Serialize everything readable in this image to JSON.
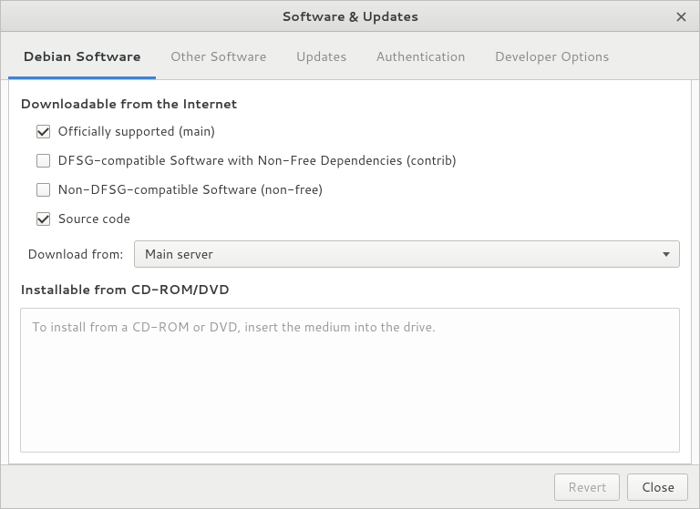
{
  "window": {
    "title": "Software & Updates"
  },
  "tabs": [
    {
      "label": "Debian Software",
      "active": true
    },
    {
      "label": "Other Software"
    },
    {
      "label": "Updates"
    },
    {
      "label": "Authentication"
    },
    {
      "label": "Developer Options"
    }
  ],
  "sections": {
    "downloadable_label": "Downloadable from the Internet",
    "cdrom_label": "Installable from CD-ROM/DVD"
  },
  "checkboxes": {
    "main": {
      "label": "Officially supported (main)",
      "checked": true
    },
    "contrib": {
      "label": "DFSG-compatible Software with Non-Free Dependencies (contrib)",
      "checked": false
    },
    "nonfree": {
      "label": "Non-DFSG-compatible Software (non-free)",
      "checked": false
    },
    "source": {
      "label": "Source code",
      "checked": true
    }
  },
  "download_from": {
    "label": "Download from:",
    "value": "Main server"
  },
  "cdrom_hint": "To install from a CD-ROM or DVD, insert the medium into the drive.",
  "footer": {
    "revert": "Revert",
    "close": "Close"
  }
}
